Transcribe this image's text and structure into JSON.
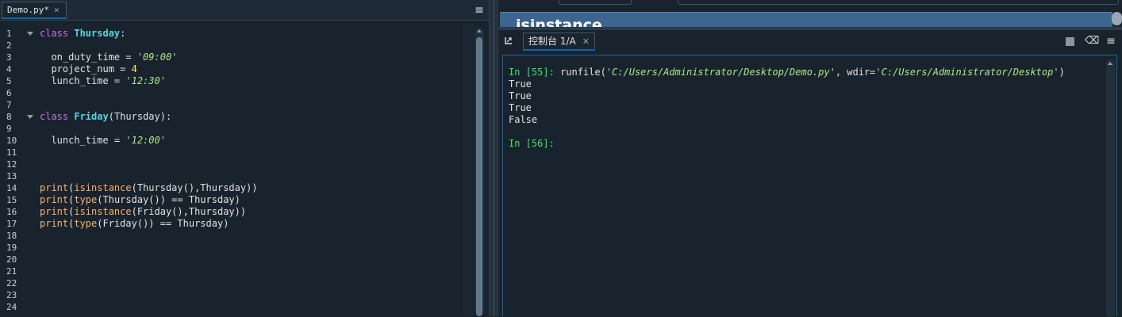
{
  "editor": {
    "tab_label": "Demo.py*",
    "tab_close": "✕",
    "menu_icon": "≡",
    "line_numbers": [
      "1",
      "2",
      "3",
      "4",
      "5",
      "6",
      "7",
      "8",
      "9",
      "10",
      "11",
      "12",
      "13",
      "14",
      "15",
      "16",
      "17",
      "18",
      "19",
      "20",
      "21",
      "22",
      "23",
      "24"
    ],
    "code": {
      "l1_kw": "class",
      "l1_name": "Thursday",
      "l1_rest": ":",
      "l3_var": "  on_duty_time = ",
      "l3_str": "'09:00'",
      "l4_var": "  project_num = ",
      "l4_num": "4",
      "l5_var": "  lunch_time = ",
      "l5_str": "'12:30'",
      "l8_kw": "class",
      "l8_name": "Friday",
      "l8_rest": "(Thursday):",
      "l10_var": "  lunch_time = ",
      "l10_str": "'12:00'",
      "l14_fn": "print",
      "l14_p1": "(",
      "l14_fn2": "isinstance",
      "l14_rest": "(Thursday(),Thursday))",
      "l15_fn": "print",
      "l15_p1": "(",
      "l15_fn2": "type",
      "l15_rest": "(Thursday()) == Thursday)",
      "l16_fn": "print",
      "l16_p1": "(",
      "l16_fn2": "isinstance",
      "l16_rest": "(Friday(),Thursday))",
      "l17_fn": "print",
      "l17_p1": "(",
      "l17_fn2": "type",
      "l17_rest": "(Friday()) == Thursday)"
    }
  },
  "help": {
    "title": "isinstance"
  },
  "console": {
    "tab_label": "控制台 1/A",
    "tab_close": "✕",
    "eraser_icon": "⌫",
    "menu_icon": "≡",
    "in55_prompt": "In [55]:",
    "in55_cmd_a": " runfile(",
    "in55_path1": "'C:/Users/Administrator/Desktop/Demo.py'",
    "in55_cmd_b": ", wdir=",
    "in55_path2": "'C:/Users/Administrator/Desktop'",
    "in55_cmd_c": ")",
    "outputs": [
      "True",
      "True",
      "True",
      "False"
    ],
    "in56_prompt": "In [56]:"
  },
  "colors": {
    "background": "#19232d",
    "accent": "#1464a0",
    "keyword": "#c670e0",
    "class_name": "#5fd1e0",
    "string": "#b0e686",
    "number": "#faed5c",
    "builtin": "#fab16c",
    "prompt": "#38e66b"
  },
  "icons": {
    "editor_menu": "hamburger-menu-icon",
    "console_undock": "undock-icon",
    "console_stop": "stop-square-icon",
    "console_clear": "eraser-icon",
    "console_menu": "hamburger-menu-icon"
  }
}
